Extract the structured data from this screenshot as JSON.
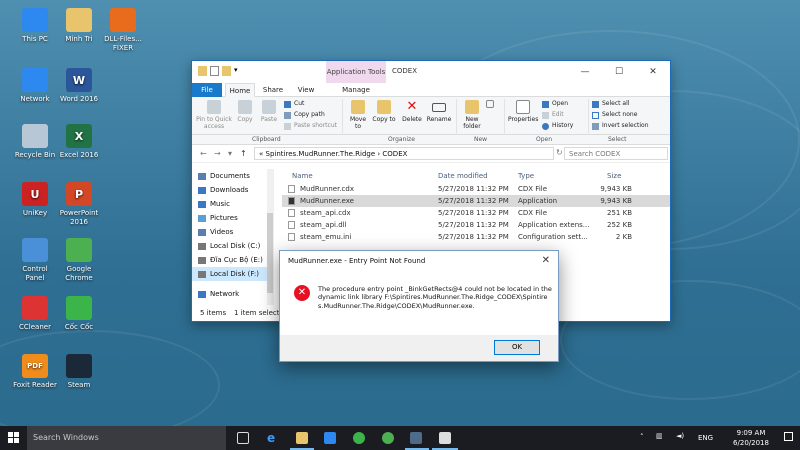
{
  "desktop": {
    "icons": [
      {
        "label": "This PC",
        "glyph": "pc-icon",
        "color": "#2d89ef"
      },
      {
        "label": "Minh Tri",
        "glyph": "user-folder-icon",
        "color": "#e8c46c"
      },
      {
        "label": "DLL-Files... FIXER",
        "glyph": "dll-fixer-icon",
        "color": "#e86c1c"
      },
      {
        "label": "Network",
        "glyph": "network-icon",
        "color": "#2d89ef"
      },
      {
        "label": "Word 2016",
        "glyph": "word-icon",
        "color": "#2b579a",
        "letter": "W"
      },
      {
        "label": "Recycle Bin",
        "glyph": "recycle-bin-icon",
        "color": "#b8c7d6"
      },
      {
        "label": "Excel 2016",
        "glyph": "excel-icon",
        "color": "#217346",
        "letter": "X"
      },
      {
        "label": "UniKey",
        "glyph": "unikey-icon",
        "color": "#cc2222",
        "letter": "U"
      },
      {
        "label": "PowerPoint 2016",
        "glyph": "powerpoint-icon",
        "color": "#d24726",
        "letter": "P"
      },
      {
        "label": "Control Panel",
        "glyph": "control-panel-icon",
        "color": "#4a90d9"
      },
      {
        "label": "Google Chrome",
        "glyph": "chrome-icon",
        "color": "#4caf50"
      },
      {
        "label": "CCleaner",
        "glyph": "ccleaner-icon",
        "color": "#d33"
      },
      {
        "label": "Cốc Cốc",
        "glyph": "coccoc-icon",
        "color": "#3bb54a"
      },
      {
        "label": "Foxit Reader",
        "glyph": "foxit-icon",
        "color": "#f08c1c",
        "letter": "PDF"
      },
      {
        "label": "Steam",
        "glyph": "steam-icon",
        "color": "#1b2838"
      }
    ]
  },
  "explorer": {
    "title": "CODEX",
    "app_tools": "Application Tools",
    "tabs": [
      "File",
      "Home",
      "Share",
      "View",
      "Manage"
    ],
    "ribbon": {
      "pin": "Pin to Quick access",
      "copy": "Copy",
      "paste": "Paste",
      "cut": "Cut",
      "copy_path": "Copy path",
      "paste_shortcut": "Paste shortcut",
      "move_to": "Move to",
      "copy_to": "Copy to",
      "delete": "Delete",
      "rename": "Rename",
      "new_folder": "New folder",
      "properties": "Properties",
      "open": "Open",
      "edit": "Edit",
      "history": "History",
      "select_all": "Select all",
      "select_none": "Select none",
      "invert_selection": "Invert selection"
    },
    "groups": [
      "Clipboard",
      "Organize",
      "New",
      "Open",
      "Select"
    ],
    "address": "«  Spintires.MudRunner.The.Ridge  ›  CODEX",
    "search_placeholder": "Search CODEX",
    "nav_items": [
      "Documents",
      "Downloads",
      "Music",
      "Pictures",
      "Videos",
      "Local Disk (C:)",
      "Đĩa Cục Bộ  (E:)",
      "Local Disk (F:)",
      "Network"
    ],
    "columns": {
      "name": "Name",
      "date": "Date modified",
      "type": "Type",
      "size": "Size"
    },
    "files": [
      {
        "name": "MudRunner.cdx",
        "date": "5/27/2018 11:32 PM",
        "type": "CDX File",
        "size": "9,943 KB"
      },
      {
        "name": "MudRunner.exe",
        "date": "5/27/2018 11:32 PM",
        "type": "Application",
        "size": "9,943 KB"
      },
      {
        "name": "steam_api.cdx",
        "date": "5/27/2018 11:32 PM",
        "type": "CDX File",
        "size": "251 KB"
      },
      {
        "name": "steam_api.dll",
        "date": "5/27/2018 11:32 PM",
        "type": "Application extens...",
        "size": "252 KB"
      },
      {
        "name": "steam_emu.ini",
        "date": "5/27/2018 11:32 PM",
        "type": "Configuration sett...",
        "size": "2 KB"
      }
    ],
    "status_items": "5 items",
    "status_selected": "1 item selected"
  },
  "dialog": {
    "title": "MudRunner.exe - Entry Point Not Found",
    "message": "The procedure entry point _BinkGetRects@4 could not be located in the dynamic link library F:\\Spintires.MudRunner.The.Ridge_CODEX\\Spintires.MudRunner.The.Ridge\\CODEX\\MudRunner.exe.",
    "ok": "OK",
    "close": "✕"
  },
  "taskbar": {
    "search_placeholder": "Search Windows",
    "time": "9:09 AM",
    "date": "6/20/2018",
    "lang": "ENG"
  }
}
